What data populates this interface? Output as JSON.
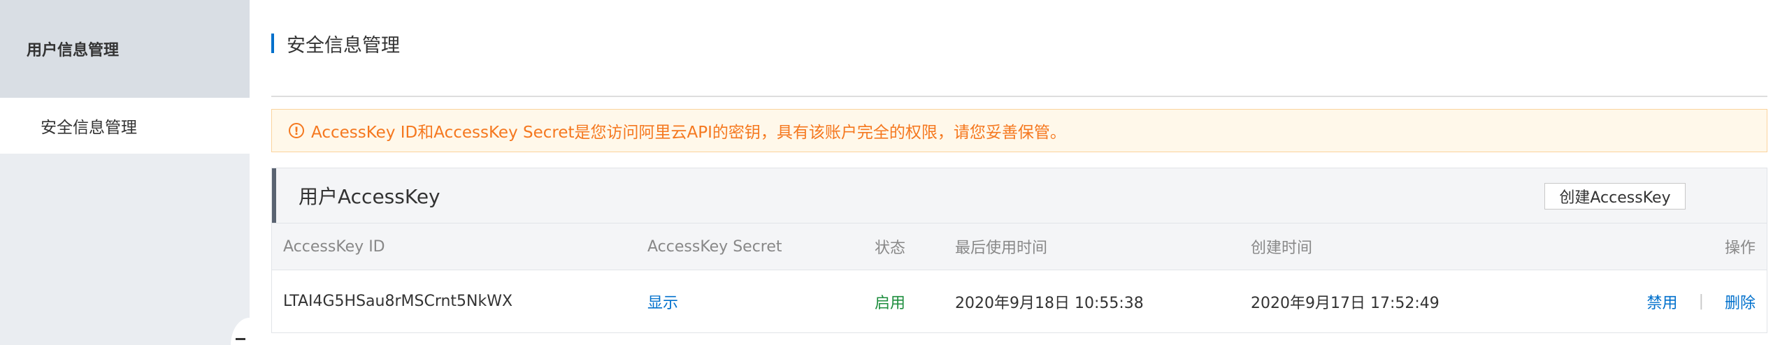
{
  "sidebar": {
    "header": "用户信息管理",
    "items": [
      {
        "label": "安全信息管理"
      }
    ]
  },
  "page": {
    "title": "安全信息管理"
  },
  "alert": {
    "icon": "!",
    "text": "AccessKey ID和AccessKey Secret是您访问阿里云API的密钥，具有该账户完全的权限，请您妥善保管。"
  },
  "panel": {
    "title": "用户AccessKey",
    "create_button": "创建AccessKey"
  },
  "table": {
    "columns": [
      "AccessKey ID",
      "AccessKey Secret",
      "状态",
      "最后使用时间",
      "创建时间",
      "操作"
    ],
    "rows": [
      {
        "id": "LTAI4G5HSau8rMSCrnt5NkWX",
        "secret_action": "显示",
        "status": "启用",
        "last_used": "2020年9月18日 10:55:38",
        "created": "2020年9月17日 17:52:49",
        "action_disable": "禁用",
        "separator": "|",
        "action_delete": "删除"
      }
    ]
  },
  "colors": {
    "accent": "#0070cc",
    "warning": "#f5781f",
    "success": "#1e8e3e"
  }
}
